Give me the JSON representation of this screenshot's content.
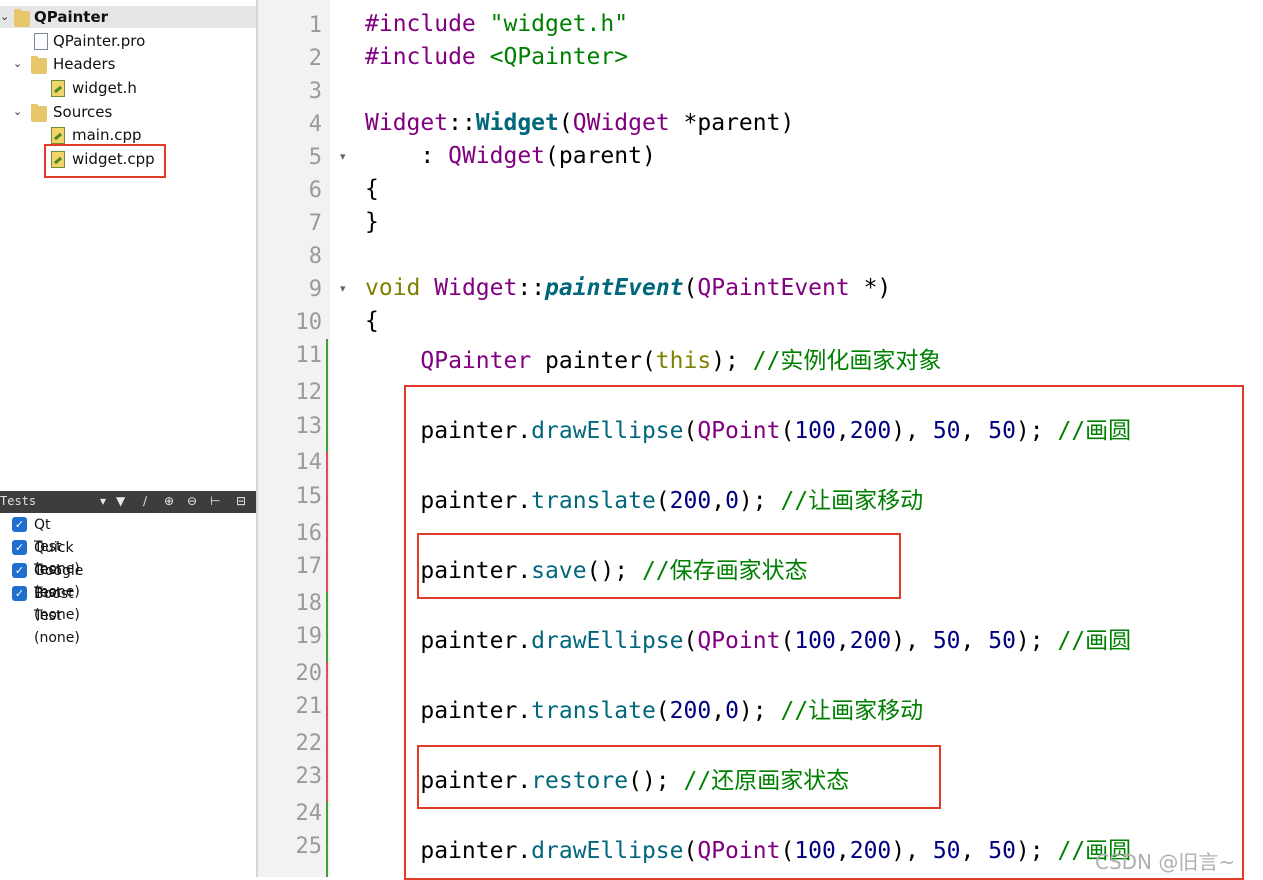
{
  "project": {
    "name": "QPainter",
    "pro_file": "QPainter.pro",
    "headers_label": "Headers",
    "header_file": "widget.h",
    "sources_label": "Sources",
    "source_files": [
      "main.cpp",
      "widget.cpp"
    ]
  },
  "tests_panel": {
    "title": "Tests",
    "items": [
      "Qt Test (none)",
      "Quick Test (none)",
      "Google Test (none)",
      "Boost Test (none)"
    ]
  },
  "editor": {
    "line_numbers": [
      "1",
      "2",
      "3",
      "4",
      "5",
      "6",
      "7",
      "8",
      "9",
      "10",
      "11",
      "12",
      "13",
      "14",
      "15",
      "16",
      "17",
      "18",
      "19",
      "20",
      "21",
      "22",
      "23",
      "24",
      "25"
    ],
    "lines": [
      "#include \"widget.h\"",
      "#include <QPainter>",
      "",
      "Widget::Widget(QWidget *parent)",
      "    : QWidget(parent)",
      "{",
      "}",
      "",
      "void Widget::paintEvent(QPaintEvent *)",
      "{",
      "    QPainter painter(this); //实例化画家对象",
      "",
      "    painter.drawEllipse(QPoint(100,200), 50, 50); //画圆",
      "",
      "    painter.translate(200,0); //让画家移动",
      "",
      "    painter.save(); //保存画家状态",
      "",
      "    painter.drawEllipse(QPoint(100,200), 50, 50); //画圆",
      "",
      "    painter.translate(200,0); //让画家移动",
      "",
      "    painter.restore(); //还原画家状态",
      "",
      "    painter.drawEllipse(QPoint(100,200), 50, 50); //画圆"
    ]
  },
  "colors": {
    "highlight_box": "#e23b2a",
    "keyword": "#808000",
    "type": "#800080",
    "function": "#00677c",
    "string_comment": "#008000",
    "number": "#000080"
  },
  "watermark": "CSDN @旧言~"
}
